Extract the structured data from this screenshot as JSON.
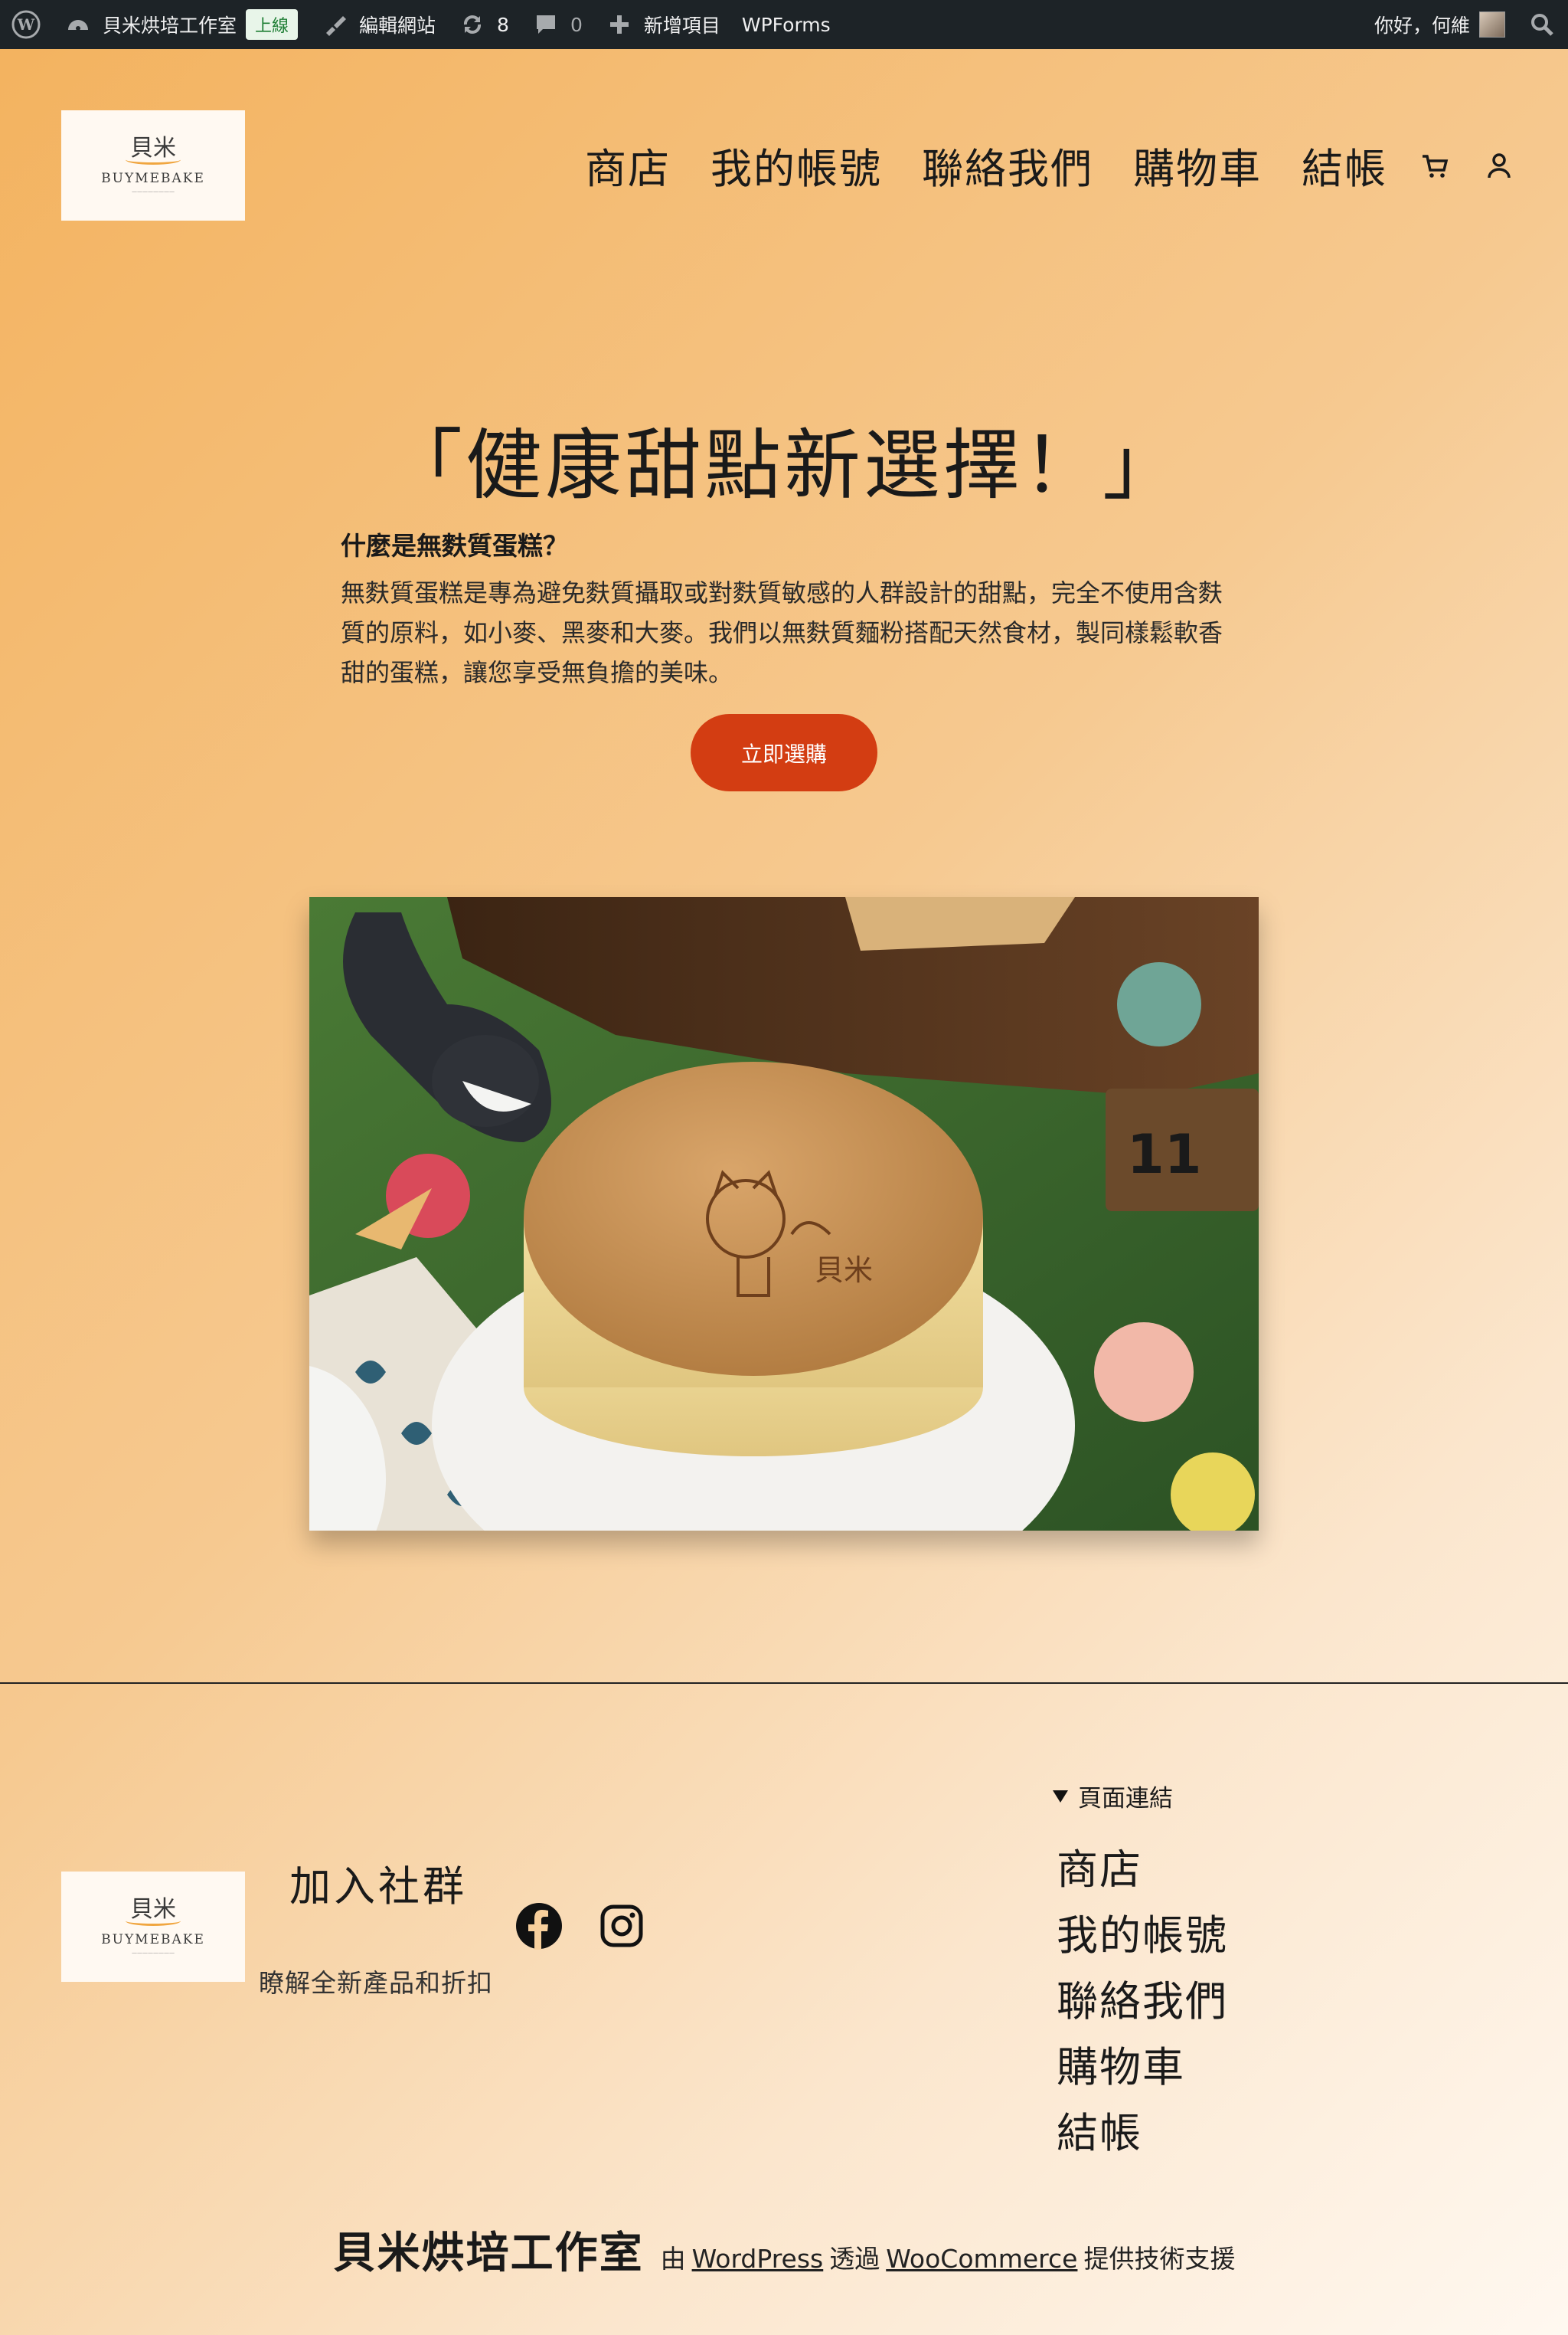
{
  "admin_bar": {
    "site_name": "貝米烘培工作室",
    "status_badge": "上線",
    "edit_site": "編輯網站",
    "updates_count": "8",
    "comments_count": "0",
    "new_item": "新增項目",
    "wpforms": "WPForms",
    "greeting": "你好，何維"
  },
  "header": {
    "logo": {
      "mark": "貝米",
      "name": "BUYMEBAKE"
    },
    "nav": [
      "商店",
      "我的帳號",
      "聯絡我們",
      "購物車",
      "結帳"
    ]
  },
  "hero": {
    "title": "「健康甜點新選擇！」",
    "question": "什麼是無麩質蛋糕？",
    "paragraph": "無麩質蛋糕是專為避免麩質攝取或對麩質敏感的人群設計的甜點，完全不使用含麩質的原料，如小麥、黑麥和大麥。我們以無麩質麵粉搭配天然食材，製同樣鬆軟香甜的蛋糕，讓您享受無負擔的美味。",
    "button": "立即選購"
  },
  "footer": {
    "logo": {
      "mark": "貝米",
      "name": "BUYMEBAKE"
    },
    "join_title": "加入社群",
    "join_sub": "瞭解全新產品和折扣",
    "social": [
      "facebook-icon",
      "instagram-icon"
    ],
    "links_title": "頁面連結",
    "links": [
      "商店",
      "我的帳號",
      "聯絡我們",
      "購物車",
      "結帳"
    ],
    "credit": {
      "name": "貝米烘培工作室",
      "prefix": "由",
      "wordpress": "WordPress",
      "via": "透過",
      "woocommerce": "WooCommerce",
      "suffix": "提供技術支援"
    }
  },
  "colors": {
    "admin_bar": "#1d2327",
    "button": "#d33d12",
    "gradient_start": "#f3b25e",
    "gradient_end": "#fff8f0"
  }
}
